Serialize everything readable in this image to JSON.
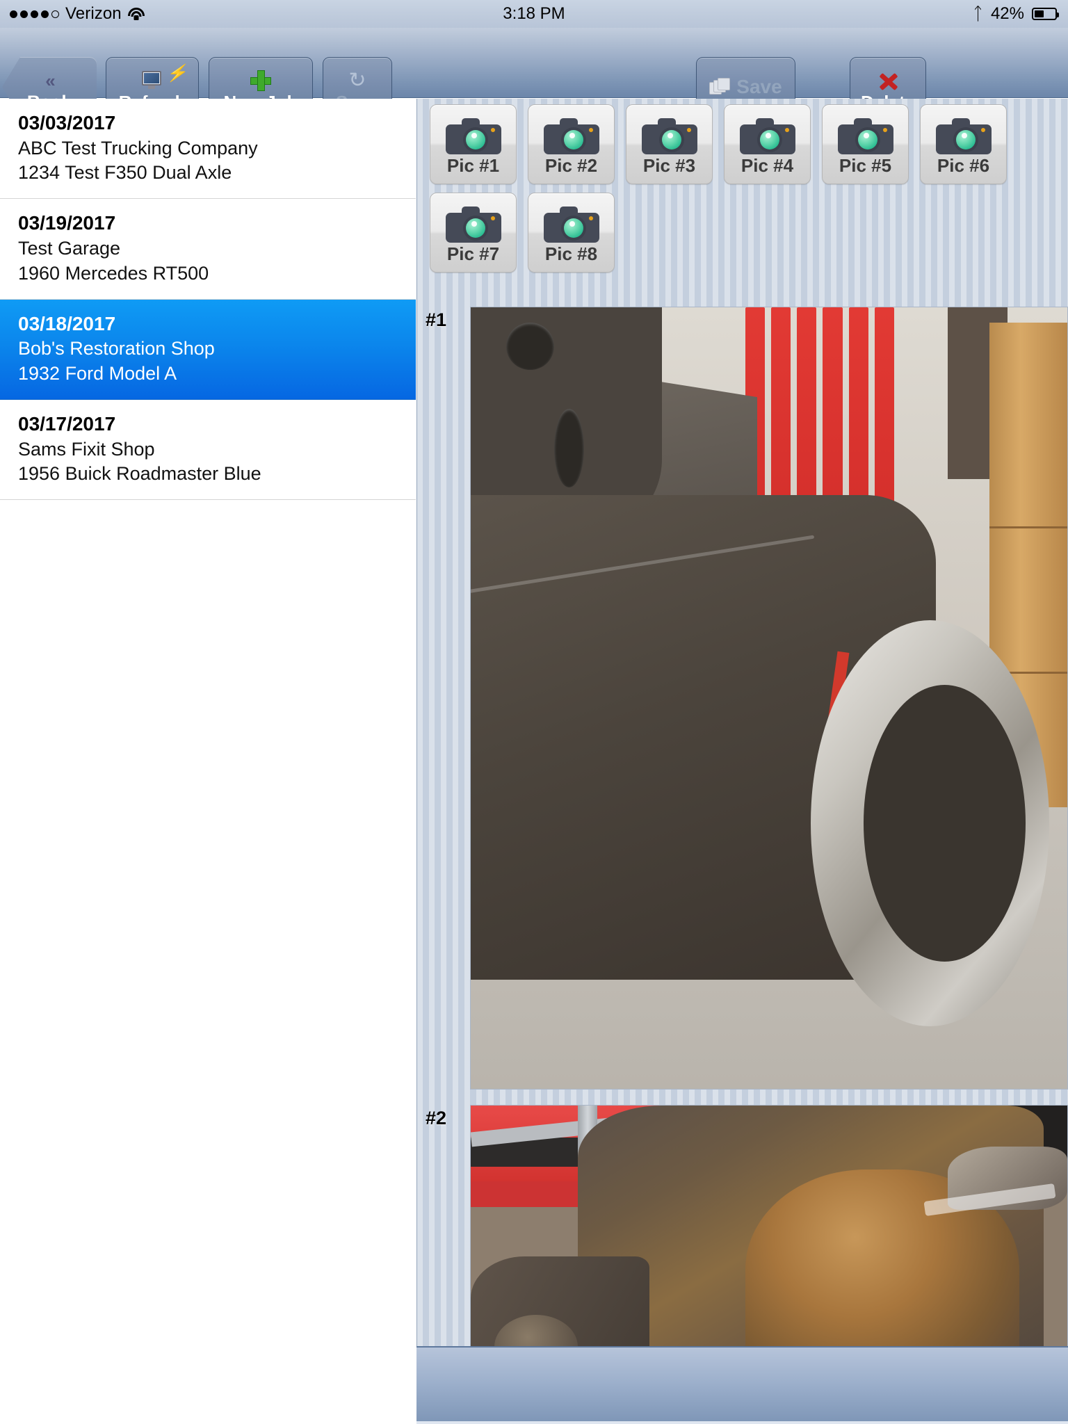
{
  "status_bar": {
    "carrier": "Verizon",
    "signal_dots_filled": 4,
    "signal_dots_total": 5,
    "wifi_icon": "wifi-icon",
    "time": "3:18 PM",
    "bluetooth_icon": "bluetooth-icon",
    "battery_percent": "42%",
    "battery_level": 42
  },
  "toolbar": {
    "back_label": "Back",
    "back_icon": "double-chevron-left-icon",
    "refresh_label": "Refresh",
    "refresh_icon": "monitor-refresh-icon",
    "new_job_label": "New Job",
    "new_job_icon": "green-plus-icon",
    "sync_label": "Sync",
    "sync_icon": "sync-circular-arrows-icon",
    "sync_disabled": true,
    "save_label": "Save",
    "save_icon": "save-disks-icon",
    "save_disabled": true,
    "delete_label": "Delete",
    "delete_icon": "red-x-icon"
  },
  "job_list": {
    "rows": [
      {
        "date": "03/03/2017",
        "shop": "ABC Test Trucking Company",
        "vehicle": "1234 Test F350 Dual Axle",
        "selected": false
      },
      {
        "date": "03/19/2017",
        "shop": "Test Garage",
        "vehicle": "1960 Mercedes RT500",
        "selected": false
      },
      {
        "date": "03/18/2017",
        "shop": "Bob's Restoration Shop",
        "vehicle": "1932 Ford Model A",
        "selected": true
      },
      {
        "date": "03/17/2017",
        "shop": "Sams Fixit Shop",
        "vehicle": "1956 Buick Roadmaster Blue",
        "selected": false
      }
    ]
  },
  "pic_buttons": {
    "icon": "camera-icon",
    "row1": [
      "Pic #1",
      "Pic #2",
      "Pic #3",
      "Pic #4",
      "Pic #5",
      "Pic #6"
    ],
    "row2": [
      "Pic #7",
      "Pic #8"
    ]
  },
  "photos": [
    {
      "number": "#1",
      "caption": ""
    },
    {
      "number": "#2",
      "caption": ""
    }
  ],
  "colors": {
    "selection_blue": "#0b86ec",
    "toolbar_blue": "#7d95b5",
    "panel_grey": "#c4cfde",
    "camera_lens_green": "#2bbd92",
    "delete_red": "#c32222",
    "new_job_green": "#3faa2c"
  }
}
